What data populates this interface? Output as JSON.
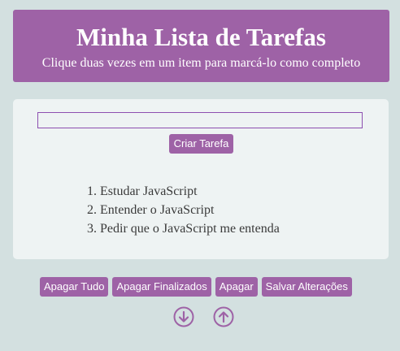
{
  "header": {
    "title": "Minha Lista de Tarefas",
    "subtitle": "Clique duas vezes em um item para marcá-lo como completo"
  },
  "form": {
    "input_value": "",
    "input_placeholder": "",
    "create_label": "Criar Tarefa"
  },
  "tasks": [
    "Estudar JavaScript",
    "Entender o JavaScript",
    "Pedir que o JavaScript me entenda"
  ],
  "actions": {
    "clear_all": "Apagar Tudo",
    "clear_completed": "Apagar Finalizados",
    "delete": "Apagar",
    "save": "Salvar Alterações"
  },
  "icons": {
    "move_down": "arrow-down-circle-icon",
    "move_up": "arrow-up-circle-icon"
  },
  "colors": {
    "accent": "#9e62a6",
    "background": "#d3e0e0",
    "card": "#eef3f3"
  }
}
